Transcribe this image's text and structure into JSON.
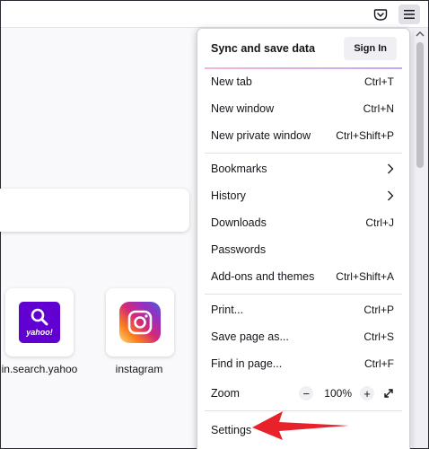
{
  "menu": {
    "sync": {
      "title": "Sync and save data",
      "signin": "Sign In"
    },
    "items": {
      "new_tab": {
        "label": "New tab",
        "shortcut": "Ctrl+T"
      },
      "new_window": {
        "label": "New window",
        "shortcut": "Ctrl+N"
      },
      "new_private": {
        "label": "New private window",
        "shortcut": "Ctrl+Shift+P"
      },
      "bookmarks": {
        "label": "Bookmarks"
      },
      "history": {
        "label": "History"
      },
      "downloads": {
        "label": "Downloads",
        "shortcut": "Ctrl+J"
      },
      "passwords": {
        "label": "Passwords"
      },
      "addons": {
        "label": "Add-ons and themes",
        "shortcut": "Ctrl+Shift+A"
      },
      "print": {
        "label": "Print...",
        "shortcut": "Ctrl+P"
      },
      "save_page": {
        "label": "Save page as...",
        "shortcut": "Ctrl+S"
      },
      "find": {
        "label": "Find in page...",
        "shortcut": "Ctrl+F"
      },
      "zoom": {
        "label": "Zoom",
        "minus": "−",
        "value": "100%",
        "plus": "+"
      },
      "settings": {
        "label": "Settings"
      }
    }
  },
  "tiles": [
    {
      "label": "in.search.yahoo",
      "logo_text": "yahoo!"
    },
    {
      "label": "instagram"
    }
  ],
  "icons": [
    "pocket-icon",
    "hamburger-menu-icon",
    "chevron-right-icon",
    "fullscreen-icon",
    "scroll-up-icon",
    "search-icon",
    "instagram-icon",
    "annotation-arrow"
  ],
  "colors": {
    "annotation_arrow": "#e8222b",
    "yahoo": "#6001d2",
    "signin_bg": "#f0f0f4"
  }
}
